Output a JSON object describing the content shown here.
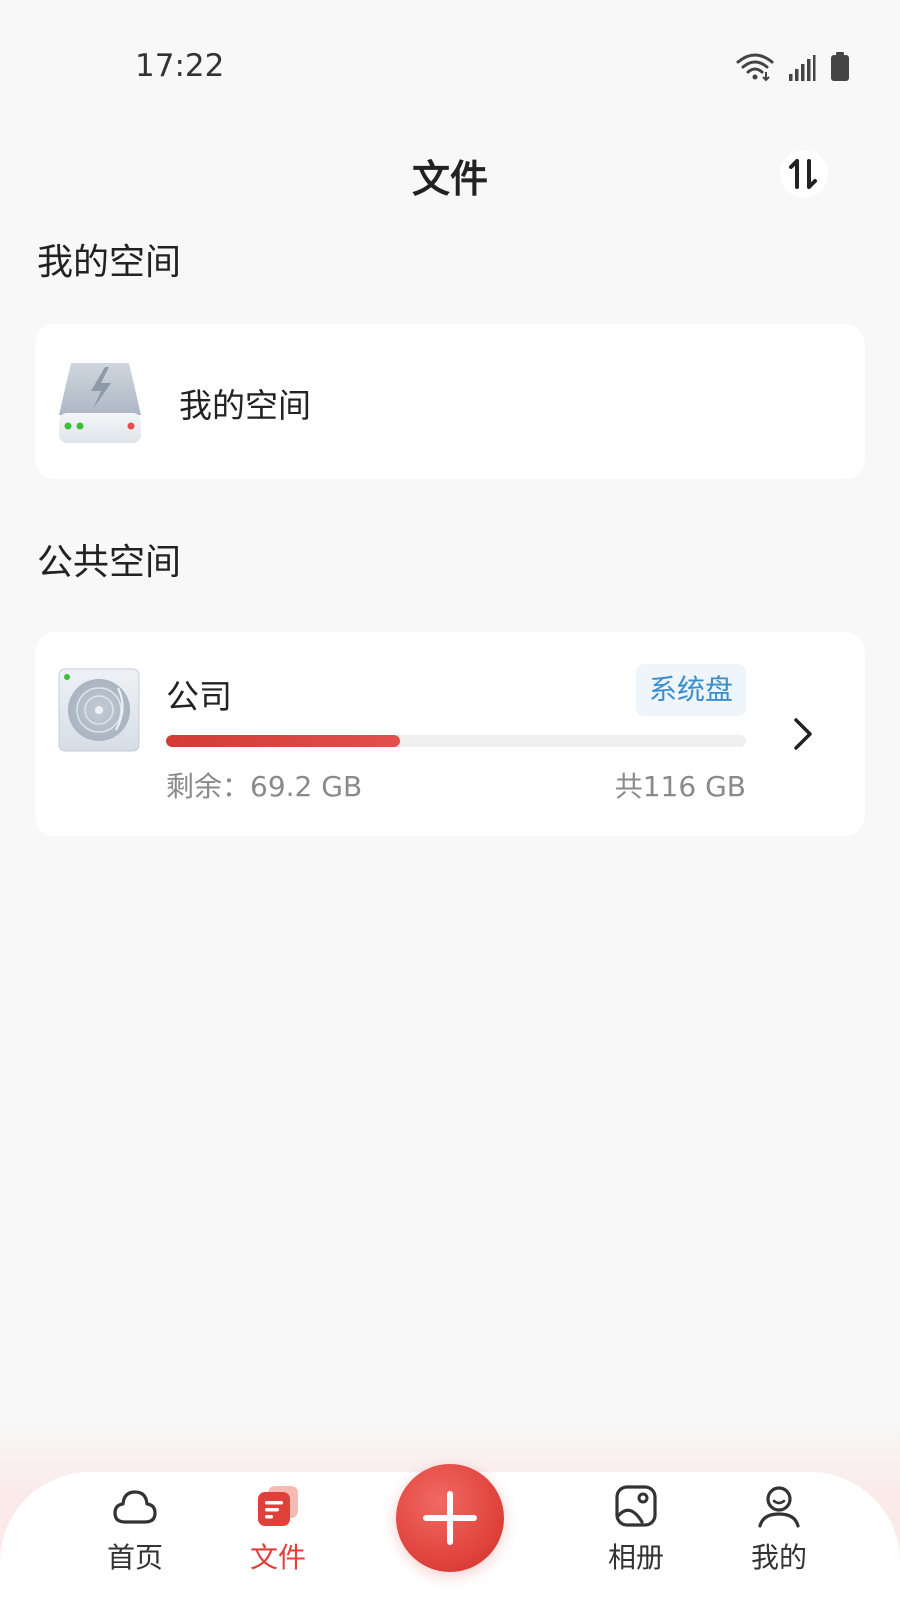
{
  "status_bar": {
    "time": "17:22"
  },
  "header": {
    "title": "文件"
  },
  "my_space": {
    "section_title": "我的空间",
    "card_label": "我的空间"
  },
  "public_space": {
    "section_title": "公共空间",
    "items": [
      {
        "name": "公司",
        "badge": "系统盘",
        "remaining": "剩余：69.2 GB",
        "total": "共116 GB",
        "used_fraction": 0.403
      }
    ]
  },
  "bottom_nav": {
    "items": [
      {
        "label": "首页",
        "icon": "cloud-icon",
        "active": false
      },
      {
        "label": "文件",
        "icon": "files-icon",
        "active": true
      },
      {
        "label": "相册",
        "icon": "album-icon",
        "active": false
      },
      {
        "label": "我的",
        "icon": "user-icon",
        "active": false
      }
    ],
    "add_icon": "plus-icon"
  },
  "colors": {
    "accent": "#e0403a",
    "badge_text": "#3a8fd0",
    "badge_bg": "#eef5fb",
    "background": "#f8f8f8"
  }
}
